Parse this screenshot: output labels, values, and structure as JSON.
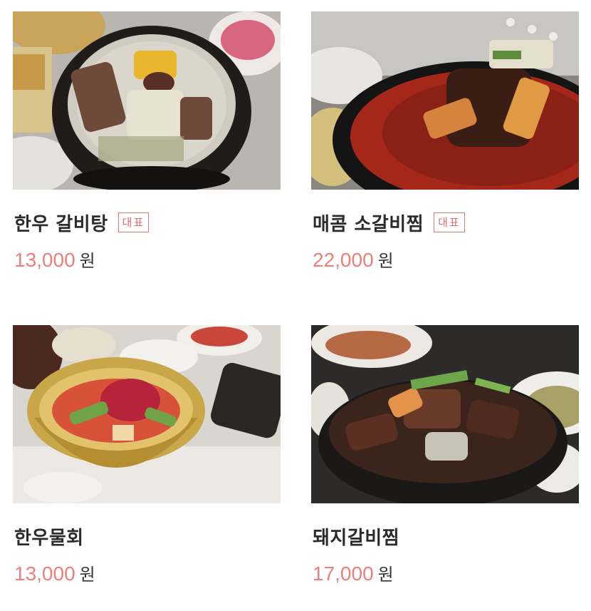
{
  "menu": {
    "items": [
      {
        "name": "한우 갈비탕",
        "badge": "대표",
        "price": "13,000",
        "unit": "원",
        "photo": "beef-short-rib-soup-image"
      },
      {
        "name": "매콤 소갈비찜",
        "badge": "대표",
        "price": "22,000",
        "unit": "원",
        "photo": "spicy-braised-beef-ribs-image"
      },
      {
        "name": "한우물회",
        "badge": "",
        "price": "13,000",
        "unit": "원",
        "photo": "beef-cold-noodle-bowl-image"
      },
      {
        "name": "돼지갈비찜",
        "badge": "",
        "price": "17,000",
        "unit": "원",
        "photo": "braised-pork-ribs-image"
      }
    ]
  },
  "colors": {
    "price": "#ea7f7c",
    "badge": "#e06d6d",
    "name": "#2b2b2b"
  }
}
